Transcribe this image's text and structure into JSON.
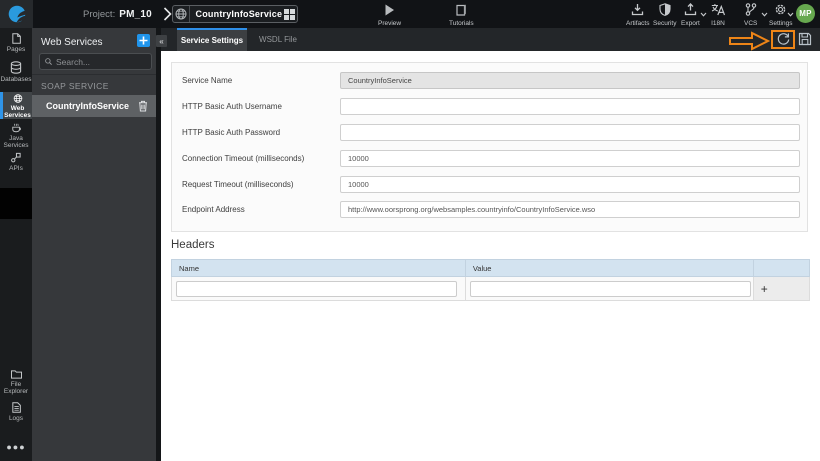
{
  "topbar": {
    "logo_icon": "wavemaker-logo-icon",
    "project_label": "Project:",
    "project_name": "PM_10",
    "service_selector": {
      "icon": "globe-icon",
      "name": "CountryInfoService",
      "grid_icon": "dashboard-grid-icon"
    },
    "center_items": [
      {
        "label": "Preview",
        "icon": "play-icon"
      },
      {
        "label": "Tutorials",
        "icon": "book-icon"
      }
    ],
    "right_items": [
      {
        "label": "Artifacts",
        "icon": "download-icon",
        "has_dropdown": false
      },
      {
        "label": "Security",
        "icon": "shield-icon",
        "has_dropdown": false
      },
      {
        "label": "Export",
        "icon": "upload-icon",
        "has_dropdown": true
      },
      {
        "label": "I18N",
        "icon": "translate-icon",
        "has_dropdown": false
      },
      {
        "label": "VCS",
        "icon": "branch-icon",
        "has_dropdown": true
      },
      {
        "label": "Settings",
        "icon": "gear-icon",
        "has_dropdown": true
      }
    ],
    "avatar": "MP"
  },
  "sidebar": {
    "items": [
      {
        "label": "Pages",
        "icon": "page-icon",
        "active": false
      },
      {
        "label": "Databases",
        "icon": "database-icon",
        "active": false
      },
      {
        "label": "Web Services",
        "icon": "globe-icon",
        "active": true
      },
      {
        "label": "Java Services",
        "icon": "coffee-icon",
        "active": false
      },
      {
        "label": "APIs",
        "icon": "api-icon",
        "active": false
      }
    ],
    "bottom_items": [
      {
        "label": "File Explorer",
        "icon": "folder-icon"
      },
      {
        "label": "Logs",
        "icon": "log-file-icon"
      }
    ],
    "more_icon": "ellipsis-icon"
  },
  "panel": {
    "title": "Web Services",
    "add_button": "+",
    "collapse_button": "«",
    "search": {
      "placeholder": "Search...",
      "icon": "search-icon"
    },
    "group_label": "SOAP SERVICE",
    "items": [
      {
        "name": "CountryInfoService",
        "delete_icon": "trash-icon",
        "selected": true
      }
    ]
  },
  "tabs": [
    {
      "label": "Service Settings",
      "active": true
    },
    {
      "label": "WSDL File",
      "active": false
    }
  ],
  "toolbar": {
    "refresh_icon": "refresh-icon",
    "save_icon": "save-icon"
  },
  "annotation": {
    "type": "arrow-and-box-highlight",
    "target": "refresh-icon",
    "color": "#ee8517"
  },
  "form": {
    "fields": [
      {
        "label": "Service Name",
        "value": "CountryInfoService",
        "disabled": true
      },
      {
        "label": "HTTP Basic Auth Username",
        "value": "",
        "disabled": false
      },
      {
        "label": "HTTP Basic Auth Password",
        "value": "",
        "disabled": false
      },
      {
        "label": "Connection Timeout (milliseconds)",
        "value": "10000",
        "disabled": false
      },
      {
        "label": "Request Timeout (milliseconds)",
        "value": "10000",
        "disabled": false
      },
      {
        "label": "Endpoint Address",
        "value": "http://www.oorsprong.org/websamples.countryinfo/CountryInfoService.wso",
        "disabled": false
      }
    ]
  },
  "headers_section": {
    "title": "Headers",
    "columns": [
      "Name",
      "Value"
    ],
    "add_button": "+",
    "rows": [
      {
        "name": "",
        "value": ""
      }
    ]
  }
}
